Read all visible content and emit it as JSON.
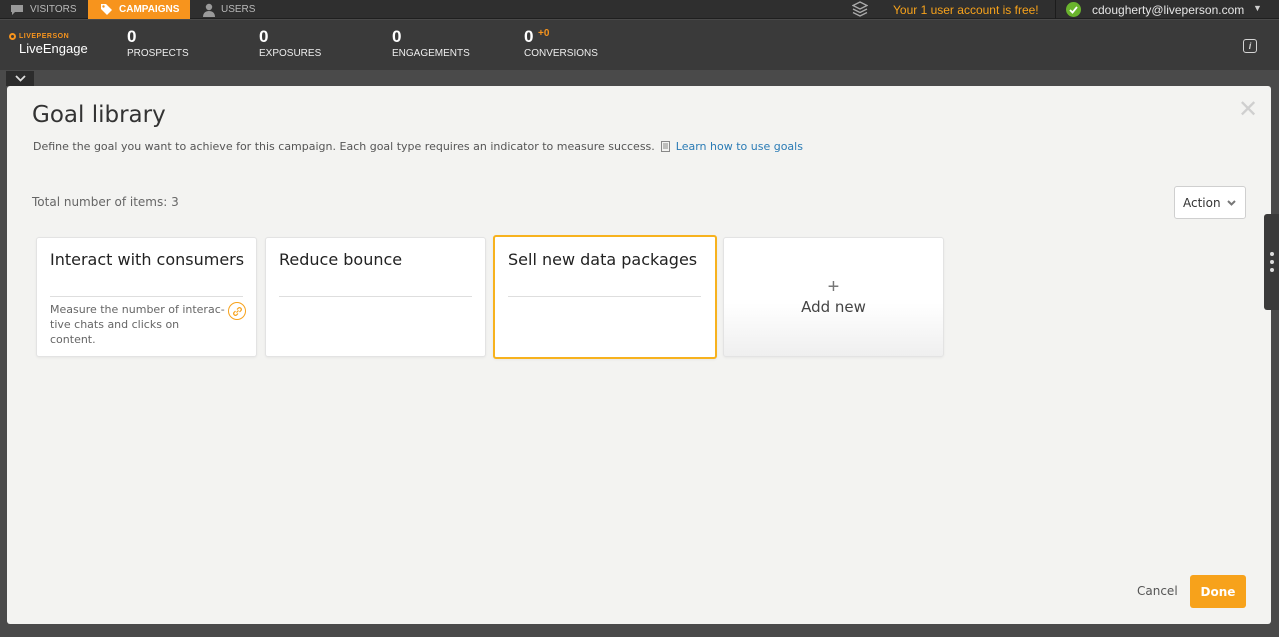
{
  "topnav": {
    "tabs": [
      {
        "label": "VISITORS",
        "icon": "chat-bubble-icon"
      },
      {
        "label": "CAMPAIGNS",
        "icon": "tag-icon"
      },
      {
        "label": "USERS",
        "icon": "user-icon"
      }
    ],
    "free_message": "Your 1 user account is free!",
    "user_email": "cdougherty@liveperson.com",
    "accent_color": "#f7941d"
  },
  "brand": {
    "small": "LIVEPERSON",
    "main": "LiveEngage"
  },
  "stats": [
    {
      "value": "0",
      "label": "PROSPECTS"
    },
    {
      "value": "0",
      "label": "EXPOSURES"
    },
    {
      "value": "0",
      "label": "ENGAGEMENTS"
    },
    {
      "value": "0",
      "label": "CONVERSIONS",
      "delta": "+0"
    }
  ],
  "modal": {
    "title": "Goal library",
    "description": "Define the goal you want to achieve for this campaign. Each goal type requires an indicator to measure success.",
    "learn_link": "Learn how to use goals",
    "total_items": "Total number of items: 3",
    "action_label": "Action",
    "cards": [
      {
        "title": "Interact with consumers",
        "description": "Measure the number of interac-tive chats and clicks on content."
      },
      {
        "title": "Reduce bounce",
        "description": ""
      },
      {
        "title": "Sell new data packages",
        "description": "",
        "selected": true
      }
    ],
    "add_new_label": "Add new",
    "add_plus": "+",
    "cancel_label": "Cancel",
    "done_label": "Done"
  }
}
